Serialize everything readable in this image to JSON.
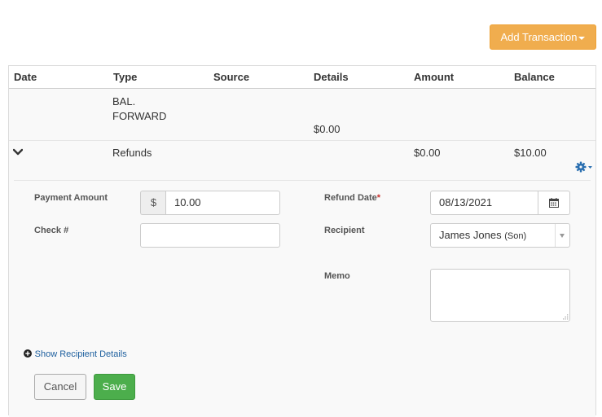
{
  "toolbar": {
    "add_transaction_label": "Add Transaction"
  },
  "table": {
    "columns": [
      "Date",
      "Type",
      "Source",
      "Details",
      "Amount",
      "Balance"
    ]
  },
  "rows": {
    "balance_forward": {
      "type_line1": "BAL.",
      "type_line2": "FORWARD",
      "details": "$0.00"
    },
    "refund": {
      "type": "Refunds",
      "amount": "$0.00",
      "balance": "$10.00"
    }
  },
  "form": {
    "payment_amount_label": "Payment Amount",
    "currency_symbol": "$",
    "payment_amount_value": "10.00",
    "check_label": "Check #",
    "check_value": "",
    "refund_date_label": "Refund Date",
    "required_mark": "*",
    "refund_date_value": "08/13/2021",
    "recipient_label": "Recipient",
    "recipient_name": "James Jones",
    "recipient_relation": "(Son)",
    "memo_label": "Memo",
    "memo_value": "",
    "show_recipient_details": "Show Recipient Details",
    "cancel_label": "Cancel",
    "save_label": "Save"
  },
  "icons": {
    "expand": "chevron-down-icon",
    "settings": "gear-icon",
    "calendar": "calendar-icon",
    "plus": "plus-circle-icon",
    "resize": "resize-grip-icon"
  },
  "colors": {
    "accent_orange": "#f0ad4e",
    "save_green": "#4cae4c",
    "link_blue": "#1d5f9e",
    "required_red": "#c9302c"
  }
}
